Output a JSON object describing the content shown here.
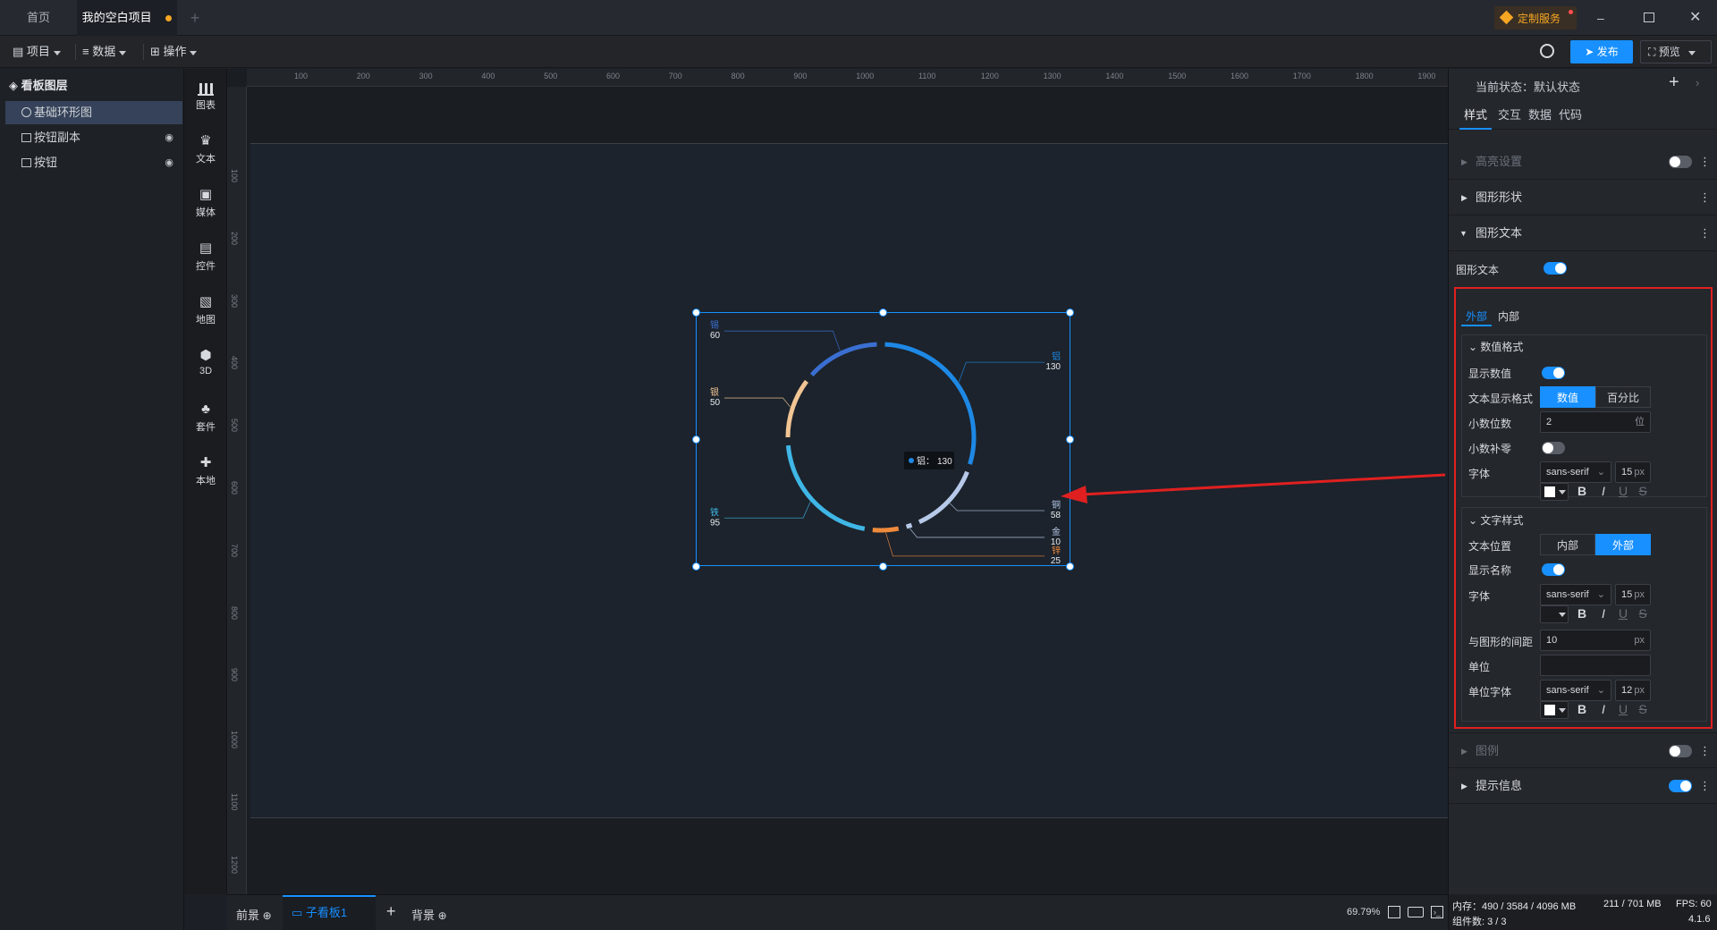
{
  "tabs": {
    "home": "首页",
    "project": "我的空白项目",
    "service": "定制服务"
  },
  "menu": {
    "project": "项目",
    "data": "数据",
    "ops": "操作",
    "publish": "发布",
    "preview": "预览"
  },
  "layers": {
    "title": "看板图层",
    "items": [
      {
        "label": "基础环形图"
      },
      {
        "label": "按钮副本"
      },
      {
        "label": "按钮"
      }
    ]
  },
  "tools": [
    "图表",
    "文本",
    "媒体",
    "控件",
    "地图",
    "3D",
    "套件",
    "本地"
  ],
  "ruler": {
    "top": [
      "100",
      "200",
      "300",
      "400",
      "500",
      "600",
      "700",
      "800",
      "900",
      "1000",
      "1100",
      "1200",
      "1300",
      "1400",
      "1500",
      "1600",
      "1700",
      "1800",
      "1900"
    ],
    "left": [
      "100",
      "200",
      "300",
      "400",
      "500",
      "600",
      "700",
      "800",
      "900",
      "1000",
      "1100",
      "1200"
    ]
  },
  "chart_data": {
    "type": "pie",
    "variant": "ring",
    "categories": [
      "铝",
      "铜",
      "金",
      "锌",
      "铁",
      "银",
      "锡"
    ],
    "values": [
      130,
      58,
      10,
      25,
      95,
      50,
      60
    ],
    "colors": [
      "#1e88e5",
      "#b7c9e8",
      "#b7c9e8",
      "#ef8a3c",
      "#3fb6e6",
      "#f2c594",
      "#3a6fd1"
    ],
    "tooltip": {
      "label": "铝：",
      "value": "130"
    }
  },
  "bottom": {
    "front": "前景",
    "subboard": "子看板1",
    "back": "背景",
    "zoom": "69.79%"
  },
  "panel": {
    "state": "当前状态：默认状态",
    "tabs": [
      "样式",
      "交互",
      "数据",
      "代码"
    ],
    "sections": {
      "highlight": "高亮设置",
      "shape": "图形形状",
      "text": "图形文本",
      "legend": "图例",
      "tip": "提示信息"
    },
    "shapeText": "图形文本",
    "subtabs": [
      "外部",
      "内部"
    ],
    "numFormat": {
      "title": "数值格式",
      "show": "显示数值",
      "format": "文本显示格式",
      "opt1": "数值",
      "opt2": "百分比",
      "decimals": "小数位数",
      "decimalsVal": "2",
      "decimalsUnit": "位",
      "pad": "小数补零",
      "font": "字体",
      "fontVal": "sans-serif",
      "size": "15",
      "px": "px"
    },
    "textStyle": {
      "title": "文字样式",
      "pos": "文本位置",
      "opt1": "内部",
      "opt2": "外部",
      "showName": "显示名称",
      "font": "字体",
      "fontVal": "sans-serif",
      "size": "15",
      "gap": "与图形的间距",
      "gapVal": "10",
      "unit": "单位",
      "unitFont": "单位字体",
      "unitFontVal": "sans-serif",
      "unitSize": "12"
    }
  },
  "status": {
    "mem": "内存：490 / 3584 / 4096 MB",
    "mem2": "211 / 701 MB",
    "fps": "FPS: 60",
    "count": "组件数: 3 / 3",
    "ver": "4.1.6"
  }
}
